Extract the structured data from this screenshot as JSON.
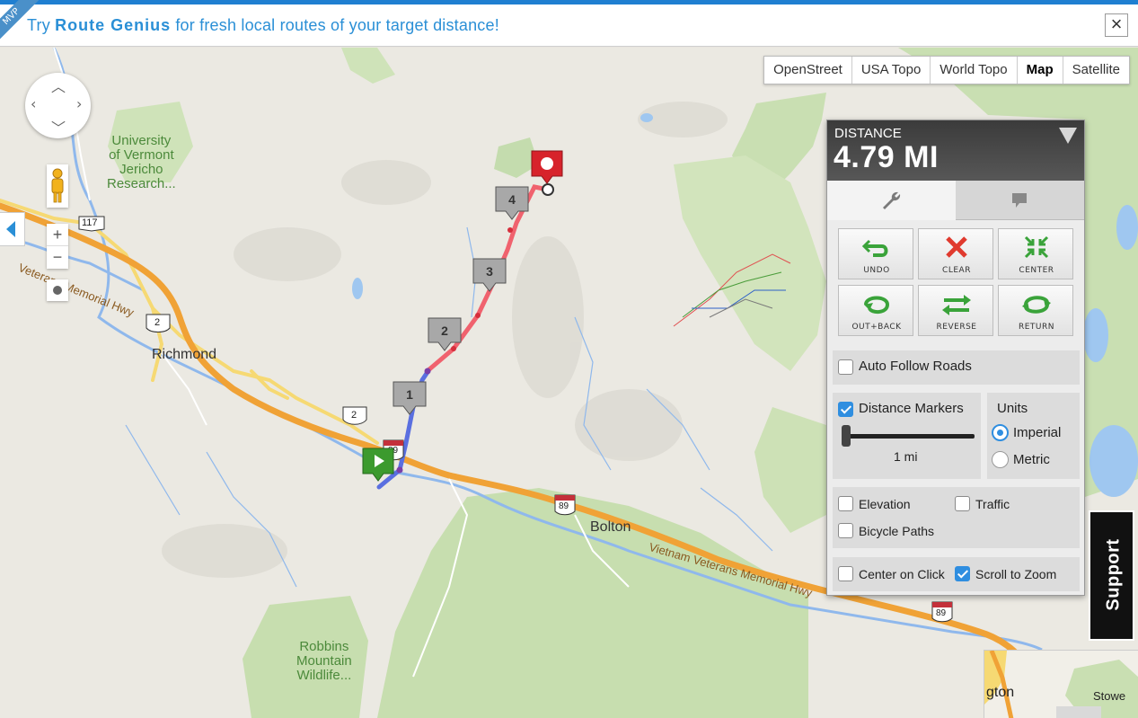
{
  "banner": {
    "ribbon": "MVP",
    "promo_prefix": "Try ",
    "promo_brand": "Route Genius",
    "promo_suffix": " for fresh local routes of your target distance!",
    "close_icon": "close-x-icon"
  },
  "map_types": [
    "OpenStreet",
    "USA Topo",
    "World Topo",
    "Map",
    "Satellite"
  ],
  "active_map_type": "Map",
  "map_labels": {
    "uvm": [
      "University",
      "of Vermont",
      "Jericho",
      "Research..."
    ],
    "richmond": "Richmond",
    "bolton": "Bolton",
    "robbins": [
      "Robbins",
      "Mountain",
      "Wildlife..."
    ],
    "veterans_hwy_west": "Veterans Memorial Hwy",
    "veterans_hwy_east": "Vietnam Veterans Memorial Hwy",
    "route_117": "117",
    "route_2a": "2",
    "route_2b": "2",
    "i89a": "89",
    "i89b": "89",
    "i89c": "89",
    "stowe": "Stowe",
    "waterbury_partial": "gton"
  },
  "route_markers": [
    "1",
    "2",
    "3",
    "4"
  ],
  "panel": {
    "label": "DISTANCE",
    "value": "4.79 MI",
    "tools": [
      {
        "label": "UNDO",
        "icon": "undo-arrow-icon"
      },
      {
        "label": "CLEAR",
        "icon": "red-x-icon"
      },
      {
        "label": "CENTER",
        "icon": "center-arrows-icon"
      },
      {
        "label": "OUT+BACK",
        "icon": "out-back-icon"
      },
      {
        "label": "REVERSE",
        "icon": "reverse-arrows-icon"
      },
      {
        "label": "RETURN",
        "icon": "return-loop-icon"
      }
    ],
    "auto_follow": {
      "label": "Auto Follow Roads",
      "checked": false
    },
    "distance_markers": {
      "label": "Distance Markers",
      "checked": true,
      "interval": "1 mi"
    },
    "units": {
      "title": "Units",
      "options": [
        "Imperial",
        "Metric"
      ],
      "selected": "Imperial"
    },
    "elevation": {
      "label": "Elevation",
      "checked": false
    },
    "traffic": {
      "label": "Traffic",
      "checked": false
    },
    "bicycle": {
      "label": "Bicycle Paths",
      "checked": false
    },
    "center_on_click": {
      "label": "Center on Click",
      "checked": false
    },
    "scroll_to_zoom": {
      "label": "Scroll to Zoom",
      "checked": true
    }
  },
  "support": "Support",
  "colors": {
    "accent": "#2a8fd6",
    "route_done": "#5a6fe0",
    "route_rest": "#f0626e",
    "start": "#3c9a2e",
    "end": "#d7232b"
  }
}
